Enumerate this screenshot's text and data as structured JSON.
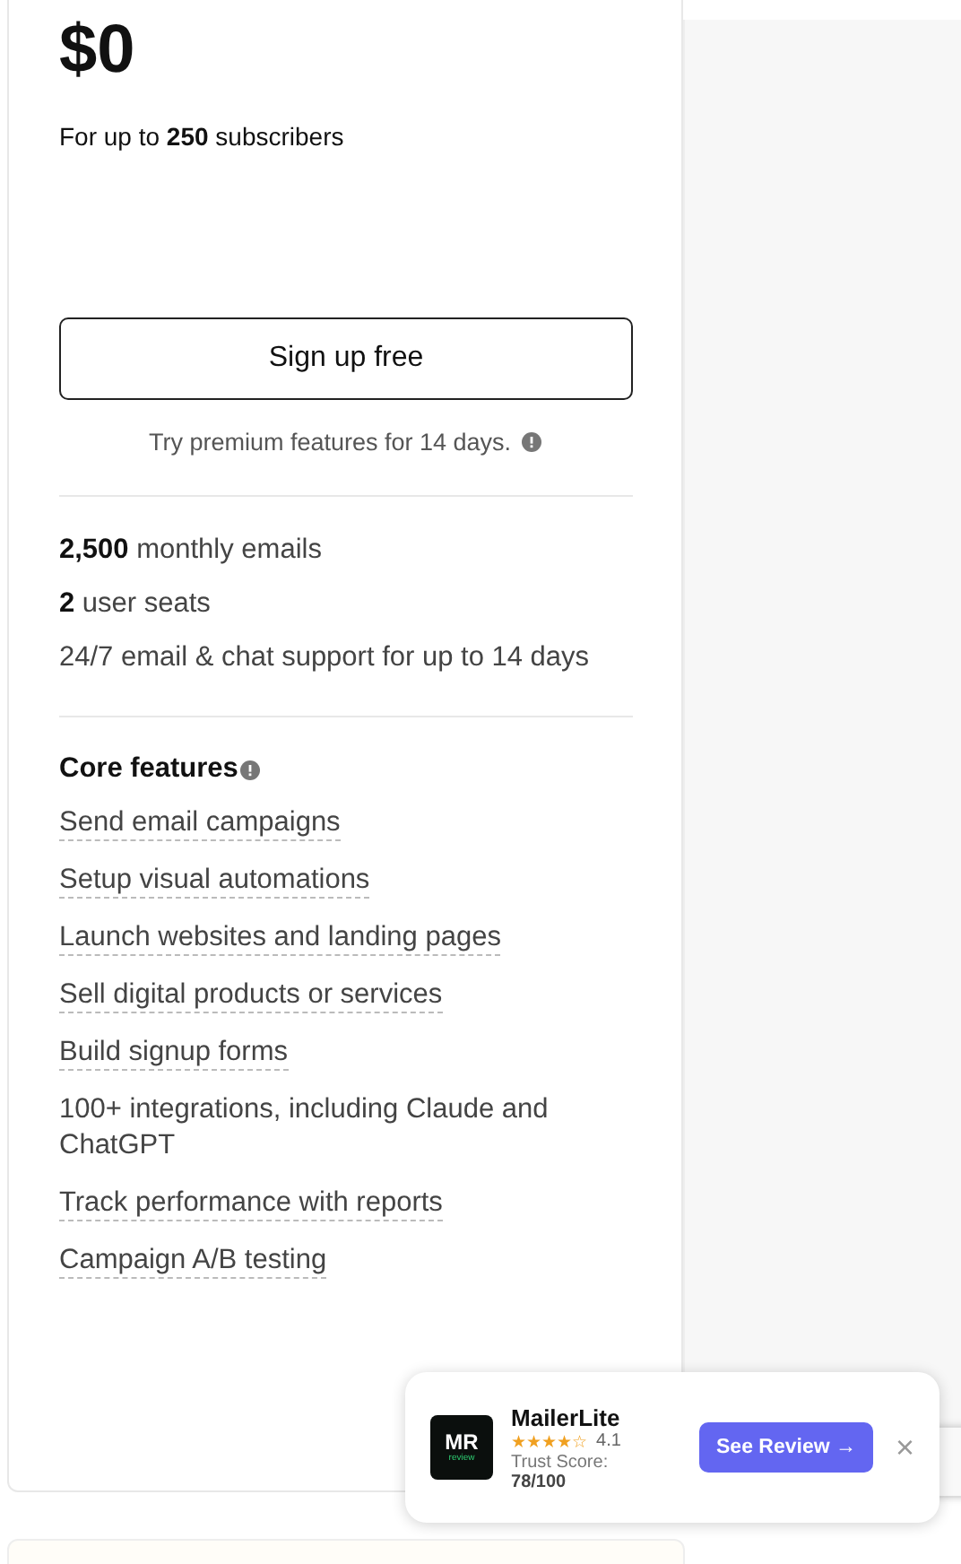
{
  "plan": {
    "price": "$0",
    "subtitle": "For up to **250** subscribers",
    "button": "Sign up free",
    "trial_note": "Try premium features for 14 days.",
    "limits": [
      "**2,500** monthly emails",
      "**2** user seats",
      "24/7 email & chat support for up to 14 days"
    ],
    "features_title": "Core features",
    "features": [
      {
        "label": "Send email campaigns",
        "kind": "link"
      },
      {
        "label": "Setup visual automations",
        "kind": "link"
      },
      {
        "label": "Launch websites and landing pages",
        "kind": "link"
      },
      {
        "label": "Sell digital products or services",
        "kind": "link"
      },
      {
        "label": "Build signup forms",
        "kind": "link"
      },
      {
        "label": "100+ integrations, including Claude and ChatGPT",
        "kind": "plain"
      },
      {
        "label": "Track performance with reports",
        "kind": "link"
      },
      {
        "label": "Campaign A/B testing",
        "kind": "link"
      }
    ]
  },
  "review_popup": {
    "logo_text": "MR",
    "logo_subtext": "review",
    "name": "MailerLite",
    "stars": 4,
    "rating": "4.1",
    "trust_label": "Trust Score:",
    "trust_value": "78/100",
    "button": "See Review →",
    "close": "×"
  }
}
